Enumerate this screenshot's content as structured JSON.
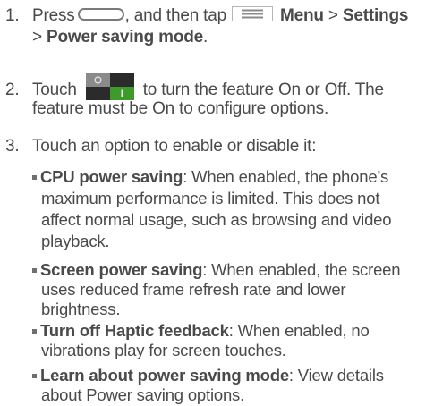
{
  "steps": [
    {
      "number": "1.",
      "t1": "Press",
      "t2": ", and then tap",
      "menu": "Menu",
      "sep1": ">",
      "settings": "Settings",
      "sep2": ">",
      "psm": "Power saving mode",
      "end": "."
    },
    {
      "number": "2.",
      "t1": "Touch",
      "t2": "to turn the feature On or Off. The",
      "line2": "feature must be On to configure options."
    },
    {
      "number": "3.",
      "text": "Touch an option to enable or disable it:"
    }
  ],
  "options": [
    {
      "title": "CPU power saving",
      "lines": [
        ": When enabled, the phone’s",
        "maximum performance is limited. This does not",
        "affect normal usage, such as browsing and video",
        "playback."
      ]
    },
    {
      "title": "Screen power saving",
      "lines": [
        ": When enabled, the screen",
        "uses reduced frame refresh rate and lower",
        "brightness."
      ]
    },
    {
      "title": "Turn off Haptic feedback",
      "lines": [
        ": When enabled, no",
        "vibrations play for screen touches."
      ]
    },
    {
      "title": "Learn about power saving mode",
      "lines": [
        ": View details",
        "about Power saving options."
      ]
    }
  ],
  "icons": {
    "home": "home-key-icon",
    "menu": "menu-key-icon",
    "toggle": "on-off-switch-icon"
  },
  "colors": {
    "text": "#4a4a4a",
    "switch_on": "#3f9a2c",
    "switch_dark": "#2b2b2b",
    "switch_grey": "#8a8a8a"
  }
}
